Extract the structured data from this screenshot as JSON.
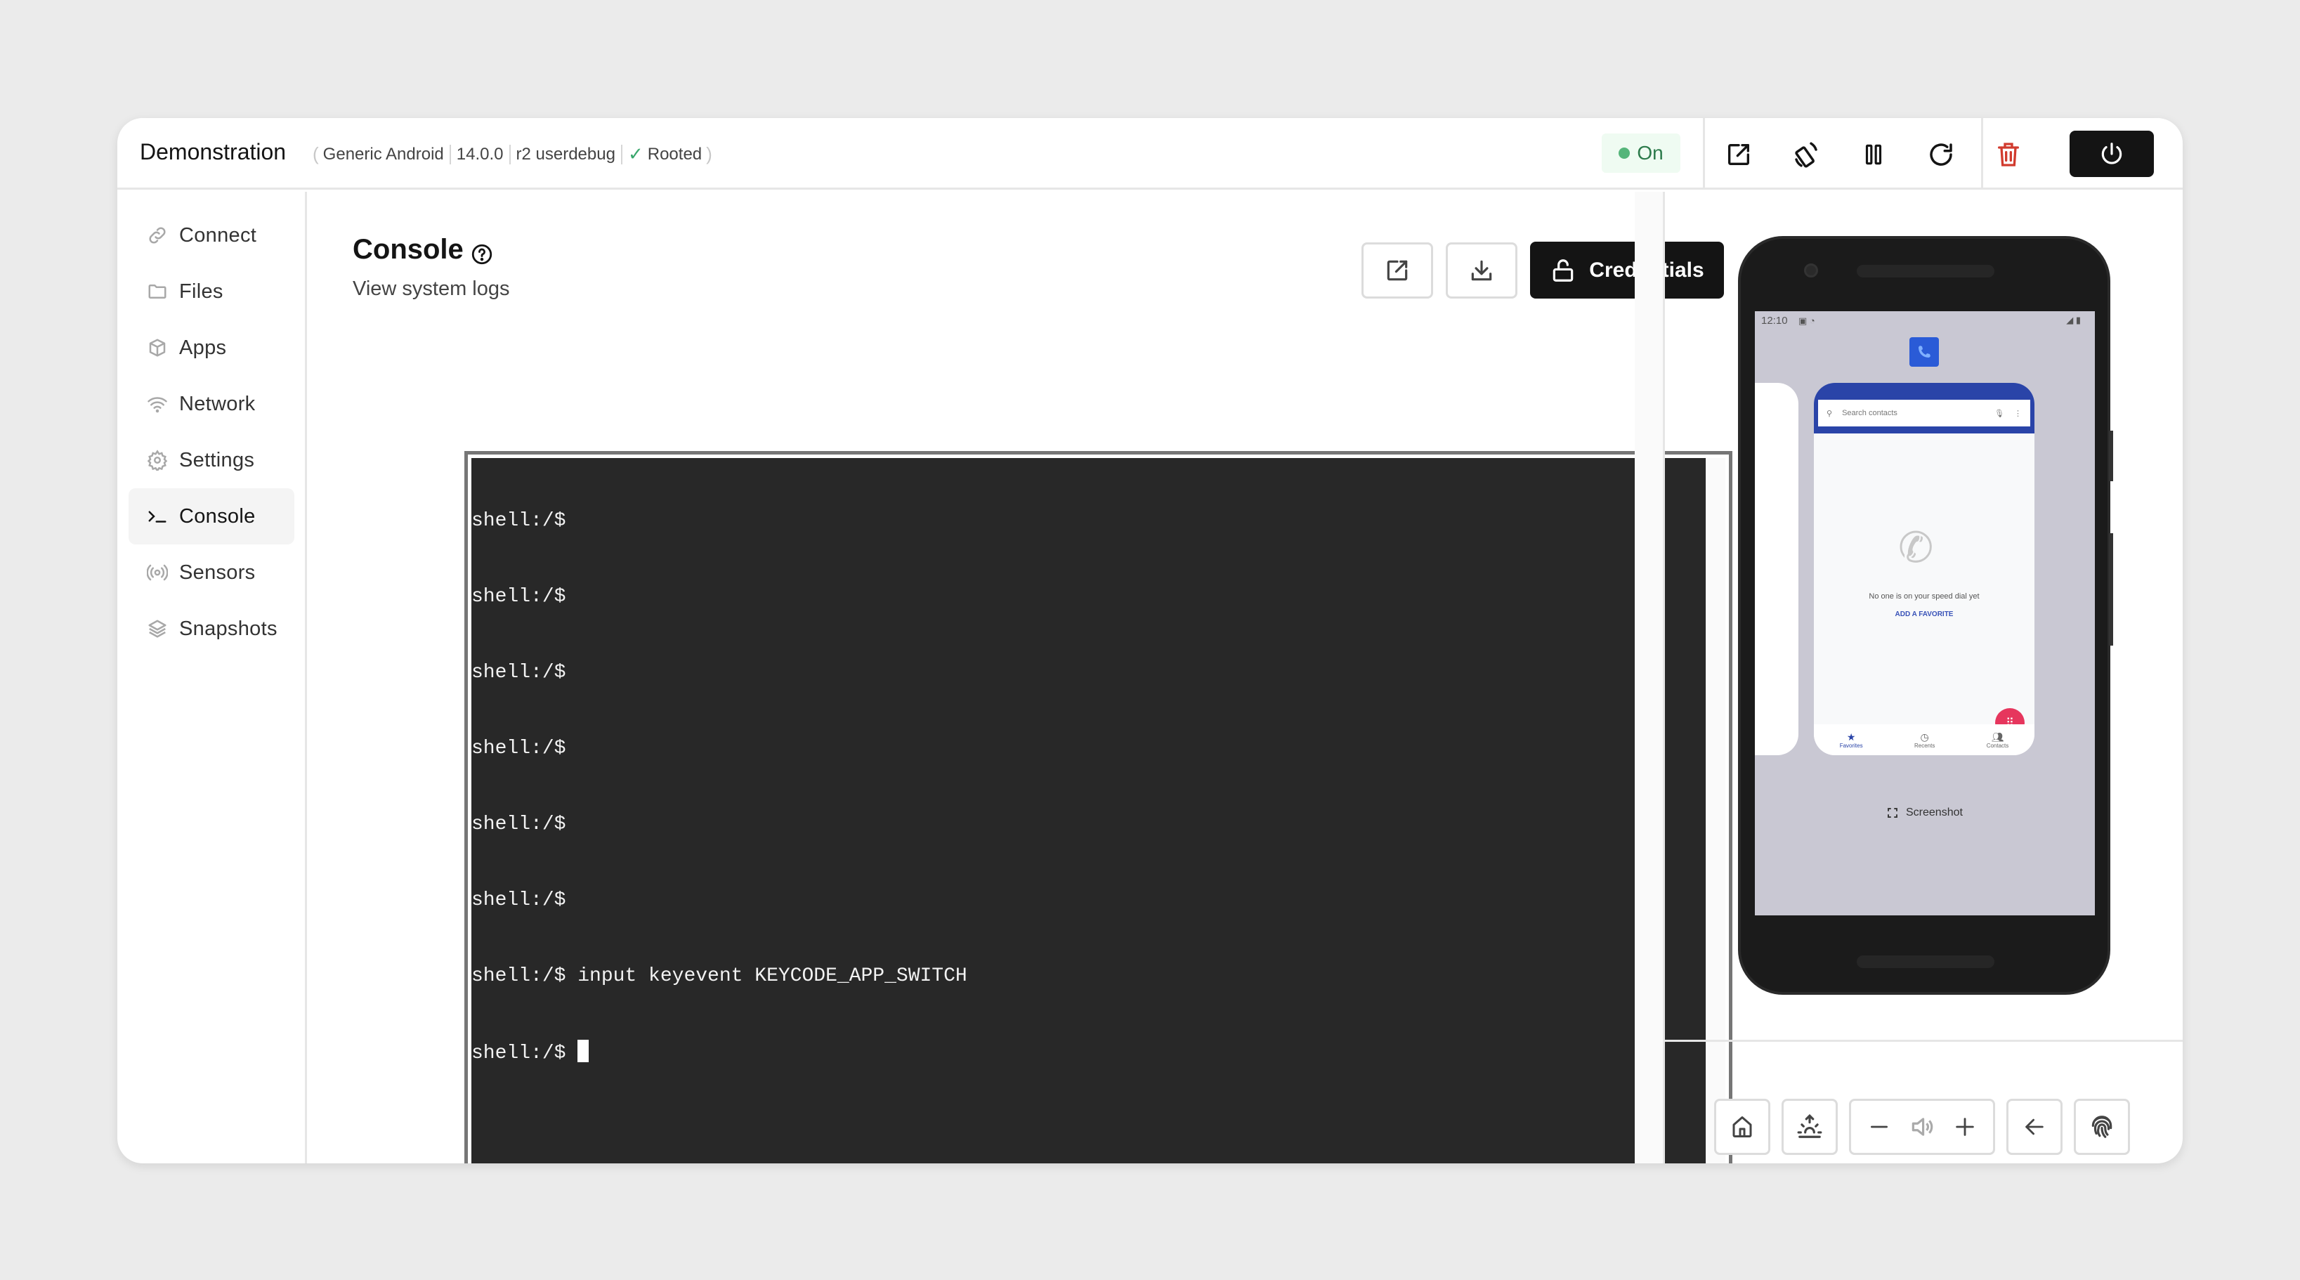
{
  "header": {
    "app_title": "Demonstration",
    "device_model": "Generic Android",
    "android_version": "14.0.0",
    "build": "r2 userdebug",
    "root_status": "Rooted",
    "status_label": "On",
    "status_color": "#55b57a",
    "actions": [
      {
        "name": "open-external",
        "icon": "external-link-icon"
      },
      {
        "name": "rotate",
        "icon": "rotate-device-icon"
      },
      {
        "name": "pause",
        "icon": "pause-icon"
      },
      {
        "name": "reload",
        "icon": "reload-icon"
      },
      {
        "name": "delete",
        "icon": "trash-icon",
        "color": "#d13b2e"
      }
    ],
    "power_icon": "power-icon"
  },
  "sidebar": {
    "items": [
      {
        "label": "Connect",
        "icon": "link-icon",
        "active": false
      },
      {
        "label": "Files",
        "icon": "folder-icon",
        "active": false
      },
      {
        "label": "Apps",
        "icon": "package-icon",
        "active": false
      },
      {
        "label": "Network",
        "icon": "wifi-icon",
        "active": false
      },
      {
        "label": "Settings",
        "icon": "gear-icon",
        "active": false
      },
      {
        "label": "Console",
        "icon": "terminal-icon",
        "active": true
      },
      {
        "label": "Sensors",
        "icon": "broadcast-icon",
        "active": false
      },
      {
        "label": "Snapshots",
        "icon": "layers-icon",
        "active": false
      }
    ]
  },
  "main": {
    "title": "Console",
    "subtitle": "View system logs",
    "credentials_label": "Credentials",
    "terminal": {
      "lines": [
        "shell:/$",
        "shell:/$",
        "shell:/$",
        "shell:/$",
        "shell:/$",
        "shell:/$",
        "shell:/$ input keyevent KEYCODE_APP_SWITCH",
        "shell:/$ "
      ]
    }
  },
  "device": {
    "status_time": "12:10",
    "search_placeholder": "Search contacts",
    "empty_text": "No one is on your speed dial yet",
    "add_favorite": "ADD A FAVORITE",
    "bottom_nav": [
      "Favorites",
      "Recents",
      "Contacts"
    ],
    "screenshot_label": "Screenshot",
    "controls": [
      "home-icon",
      "wake-icon",
      "volume-down-icon",
      "volume-icon",
      "volume-up-icon",
      "back-icon",
      "fingerprint-icon"
    ]
  }
}
